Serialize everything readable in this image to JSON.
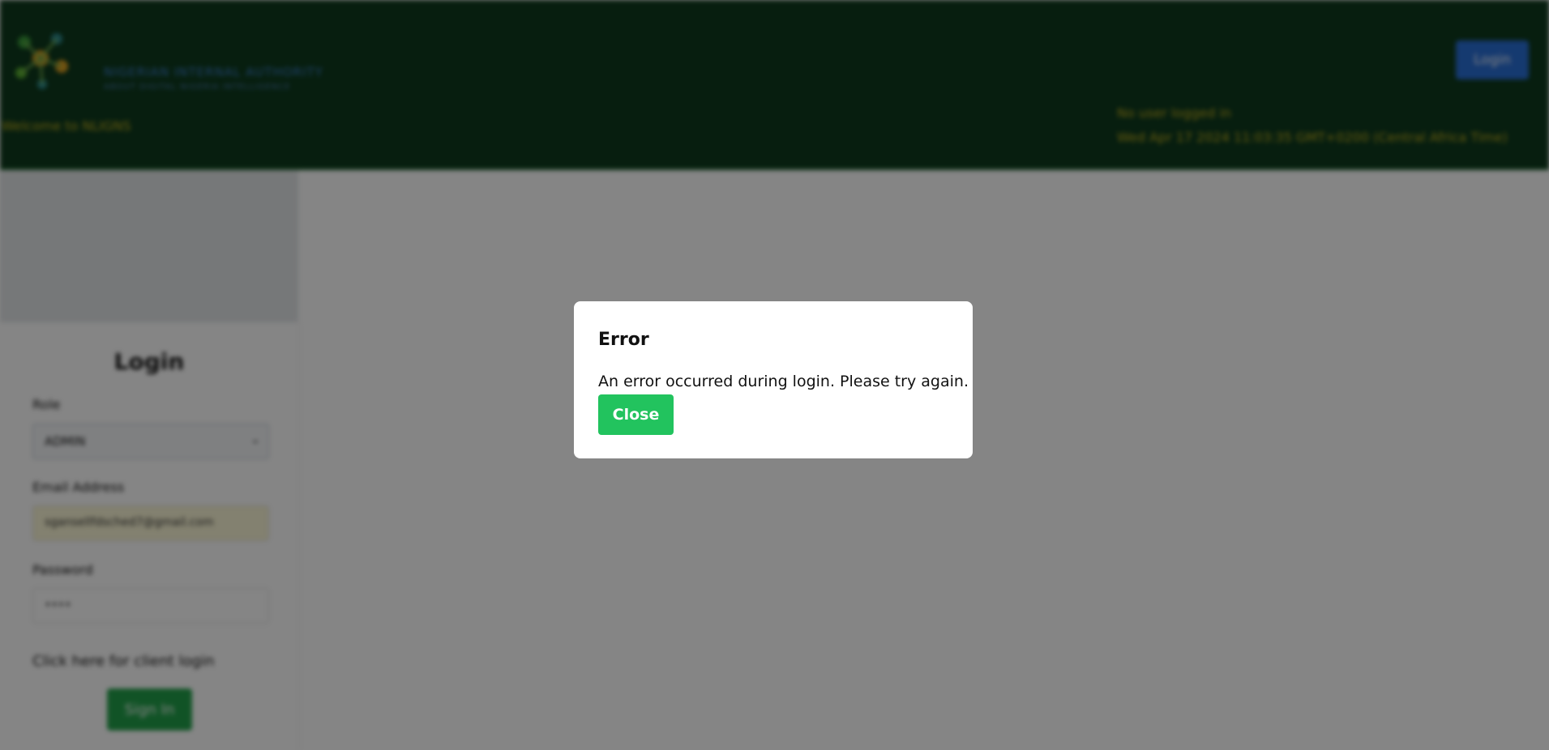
{
  "header": {
    "brand_name": "NIGERIAN INTERNAL AUTHORITY",
    "brand_tagline": "ABOUT DIGITAL NIGERIA INTELLIGENCE",
    "welcome": "Welcome to NLIGNS",
    "login_button": "Login",
    "user_status": "No user logged in",
    "datetime": "Wed Apr 17 2024 11:03:35 GMT+0200 (Central Africa Time)"
  },
  "login_form": {
    "heading": "Login",
    "role_label": "Role",
    "role_value": "ADMIN",
    "email_label": "Email Address",
    "email_value": "sgansellfdsched7@gmail.com",
    "password_label": "Password",
    "password_value": "••••",
    "client_login_link": "Click here for client login",
    "signin_button": "Sign In"
  },
  "modal": {
    "title": "Error",
    "message": "An error occurred during login. Please try again.",
    "close_button": "Close"
  },
  "colors": {
    "header_bg": "#0e3a1d",
    "accent_yellow": "#c7b11d",
    "close_button": "#22c35e",
    "overlay": "rgba(0,0,0,0.48)"
  }
}
